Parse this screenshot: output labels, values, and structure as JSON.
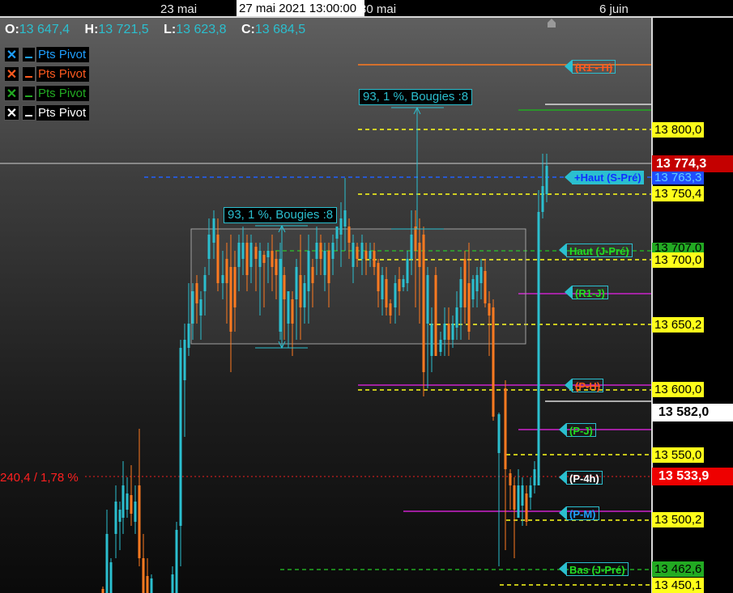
{
  "timeline": {
    "date_labels": [
      "23 mai",
      "30 mai",
      "6 juin"
    ],
    "cursor_label": "27 mai 2021 13:00:00"
  },
  "ohlc": {
    "open_label": "O:",
    "open": "13 647,4",
    "high_label": "H:",
    "high": "13 721,5",
    "low_label": "L:",
    "low": "13 623,8",
    "close_label": "C:",
    "close": "13 684,5"
  },
  "legend": [
    {
      "check": "✕",
      "name": "Pts Pivot",
      "color": "#1e9fff"
    },
    {
      "check": "✕",
      "name": "Pts Pivot",
      "color": "#ff5a1f"
    },
    {
      "check": "✕",
      "name": "Pts Pivot",
      "color": "#22aa22"
    },
    {
      "check": "✕",
      "name": "Pts Pivot",
      "color": "#ffffff"
    }
  ],
  "price_axis": {
    "labels": [
      "13 800,0",
      "13 750,4",
      "13 700,0",
      "13 650,2",
      "13 600,0",
      "13 550,0",
      "13 500,2",
      "13 462,6",
      "13 450,1"
    ],
    "current_price": "13 774,3",
    "cursor_price": "13 582,0",
    "crosshair_price": "13 533,9",
    "haut_s_pre_value": "13 763,3",
    "haut_j_pre_value": "13 707,0"
  },
  "pivots": [
    {
      "label": "(R1 - H)",
      "color": "#ff5a1f"
    },
    {
      "label": "+Haut (S-Pré)",
      "color": "#2060ff"
    },
    {
      "label": "Haut (J-Pré)",
      "color": "#22bb22"
    },
    {
      "label": "(R1-J)",
      "color": "#22bb22"
    },
    {
      "label": "(P-H)",
      "color": "#ff5a1f"
    },
    {
      "label": "(P-J)",
      "color": "#22bb22"
    },
    {
      "label": "(P-4h)",
      "color": "#ffffff"
    },
    {
      "label": "(P-M)",
      "color": "#1e9fff"
    },
    {
      "label": "Bas (J-Pré)",
      "color": "#22bb22"
    }
  ],
  "measures": [
    {
      "label": "93, 1 %, Bougies :8"
    },
    {
      "label": "93, 1 %, Bougies :8"
    }
  ],
  "crosshair_text": "240,4 / 1,78 %",
  "colors": {
    "bull": "#2bbfcf",
    "bear": "#ff7a20",
    "accent_cyan": "#2bbfcf",
    "current_price_bg": "#c40000",
    "crosshair_price_bg": "#ee0000",
    "yellow_level": "#ffff1a"
  }
}
